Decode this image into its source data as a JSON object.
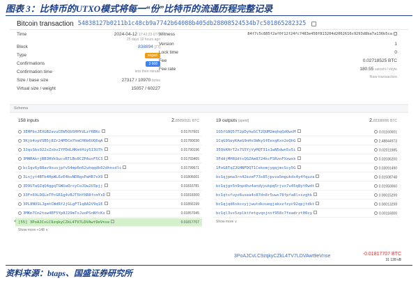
{
  "caption_top": "图表 3：比特币的UTXO模式将每一“份”比特币的流通历程完整记录",
  "caption_bottom": "资料来源：btaps、国盛证券研究所",
  "header": {
    "title": "Bitcoin transaction",
    "hash": "54838127b0211b1c48cb9a7742b64088b405db28808524534b7c501865282325"
  },
  "left_details": [
    {
      "label": "Time",
      "value": "2024-04-12",
      "value2": "17:42:23 UTC",
      "sub": "25 days 19 hours ago"
    },
    {
      "label": "Block",
      "value": "838894",
      "value2": "[77]"
    },
    {
      "label": "Type",
      "badge": "segwit"
    },
    {
      "label": "Confirmations",
      "badge": "3 668"
    },
    {
      "label": "Confirmation time",
      "value": "less then minute"
    },
    {
      "label": "Size / base size",
      "value": "27317 / 10970",
      "unit": "bytes"
    },
    {
      "label": "Virtual size / weight",
      "value": "15057 / 60227"
    }
  ],
  "right_details": [
    {
      "label": "Witness",
      "value": "84f7c5c885f2af0f12f24fc7483e458f813204d2062616c9293d8ba7a136b5ca"
    },
    {
      "label": "Version",
      "value": "1"
    },
    {
      "label": "Lock time",
      "value": "0"
    },
    {
      "label": "Fee",
      "value": "0.02718525 BTC"
    },
    {
      "label": "Fee rate",
      "value": "180.55",
      "unit": "satoshi / vbyte"
    }
  ],
  "raw_transaction": "Raw transaction",
  "schema_label": "Schema",
  "inputs": {
    "count": "158 inputs",
    "total_big": "2.",
    "total_small": "85056531",
    "unit": "BTC",
    "items": [
      {
        "addr": "3EHPbxJEXGB2avuCEW5Qb5HHYdLzf6BKc",
        "val": "0.01767601"
      },
      {
        "addr": "3Kjb4vpVSB5j8Zr24M5Cm7hmCH6b6UQ6qA",
        "val": "0.01780030"
      },
      {
        "addr": "3JqsSbs922xZxbvIYPDdLHKmtHiy5I3U7h",
        "val": "0.01790196"
      },
      {
        "addr": "3MHRAkrjRB3HVk9ucvRTLBo8CZPAuoF5C3",
        "val": "0.01793465"
      },
      {
        "addr": "bc1qv6y88av9susjpfv54mp6n62uhqqdk02dhnsdlc",
        "val": "0.01799671"
      },
      {
        "addr": "3Lnjyt4BTb4HpWL6zE4bvNDRqsPaHR7xX9",
        "val": "0.01806001"
      },
      {
        "addr": "3D9U7aQZqQ4ggqTGWUaQrsyCoJQw2U3pjj",
        "val": "0.01816781"
      },
      {
        "addr": "33Fn69LDQLeTPcGR1g4vBJT5hYXR8fcmYsD",
        "val": "0.01818300"
      },
      {
        "addr": "3PL8NUSLJgmtCWdRf2jGLgFT1q8A2V9q1E",
        "val": "0.01856199"
      },
      {
        "addr": "3MKm7Cm2tow4EF5Yp8J29mTsJuoPSnNYcKx",
        "val": "0.01857045"
      },
      {
        "addr": "[55] 3PoAJCvLC9zqkyCZkL4TV7LDVAwt9eVnse",
        "val": "0.01817707",
        "highlight": true
      }
    ],
    "show_more": "Show more +148 ∨"
  },
  "outputs": {
    "count": "19 outputs",
    "spent": "[spent]",
    "total_big": "2.",
    "total_small": "82338006",
    "unit": "BTC",
    "items": [
      {
        "addr": "1G5fG8Q57T2pDyhwSCT2QUM2mqhqQdQwcM",
        "val": "0.01160001"
      },
      {
        "addr": "1CqG9SeyKAeG9nHsSWkySfEexqKxn2oQhG",
        "val": "2.48844973"
      },
      {
        "addr": "35QkKHrT2x7S5YjVyMQT31x1wN5dwn5v5i",
        "val": "0.02011985"
      },
      {
        "addr": "3FddjMH6UdtsQGZAm8724kcFSRznFXxwxk",
        "val": "0.02036200"
      },
      {
        "addr": "1FoG8TqZJGHNFDQT1CekomjygqjmcScy5G",
        "val": "0.03091490"
      },
      {
        "addr": "bc1qjpma3rn42ezeF73s85jpvza5mgukds4y4fquza",
        "val": "0.01508748"
      },
      {
        "addr": "bc1qjgn5n9npdhz4andyyukpq5rjvx7u45q8yt0wdt",
        "val": "0.01950060"
      },
      {
        "addr": "bc1qtsfuyx6usea4s87dn8r5uws78fpfa8lsszghk",
        "val": "0.00015299"
      },
      {
        "addr": "bc1qjqd6skccyjjwutdkxuegjakxzfzyc92qpjtdkt",
        "val": "0.00013299"
      },
      {
        "addr": "bc1ql3vs5zplktfetgvqnjnsf958c7feadrzt00cy",
        "val": "0.00116000"
      }
    ],
    "show_more": "Show more ∨"
  },
  "summary": {
    "addr": "3PoAJCvLC9zqkyCZkL4TV7LDVAwt9eVnse",
    "value": "-0.01817707 BTC",
    "size": "31 128 vB"
  },
  "colors": {
    "brand": "#1b3f8a",
    "link": "#3b6bc7",
    "highlight": "#d7f0cc",
    "negative": "#d93030",
    "segwit_badge": "#f39c12",
    "confirm_badge": "#3b82f6"
  }
}
